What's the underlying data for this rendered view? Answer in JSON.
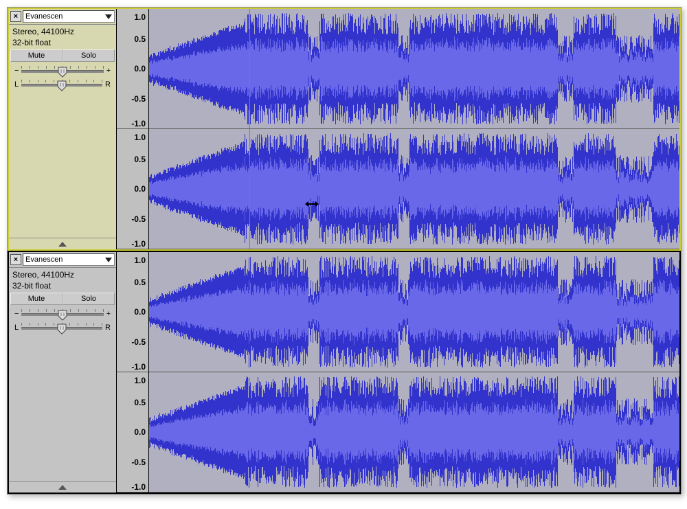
{
  "ruler_labels": [
    "1.0",
    "0.5",
    "0.0",
    "-0.5",
    "-1.0"
  ],
  "tracks": [
    {
      "name": "Evanescen",
      "info_line1": "Stereo, 44100Hz",
      "info_line2": "32-bit float",
      "mute_label": "Mute",
      "solo_label": "Solo",
      "gain_minus": "−",
      "gain_plus": "+",
      "pan_left": "L",
      "pan_right": "R",
      "selected": true,
      "show_cursor": true
    },
    {
      "name": "Evanescen",
      "info_line1": "Stereo, 44100Hz",
      "info_line2": "32-bit float",
      "mute_label": "Mute",
      "solo_label": "Solo",
      "gain_minus": "−",
      "gain_plus": "+",
      "pan_left": "L",
      "pan_right": "R",
      "selected": false,
      "show_cursor": false
    }
  ],
  "wave_seed_note": "waveform amplitude envelope: ramped intro to ~18%, then loud sustained section",
  "colors": {
    "wave_peak": "#3232cc",
    "wave_rms": "#6868e8",
    "bg": "#b0b0c0"
  }
}
